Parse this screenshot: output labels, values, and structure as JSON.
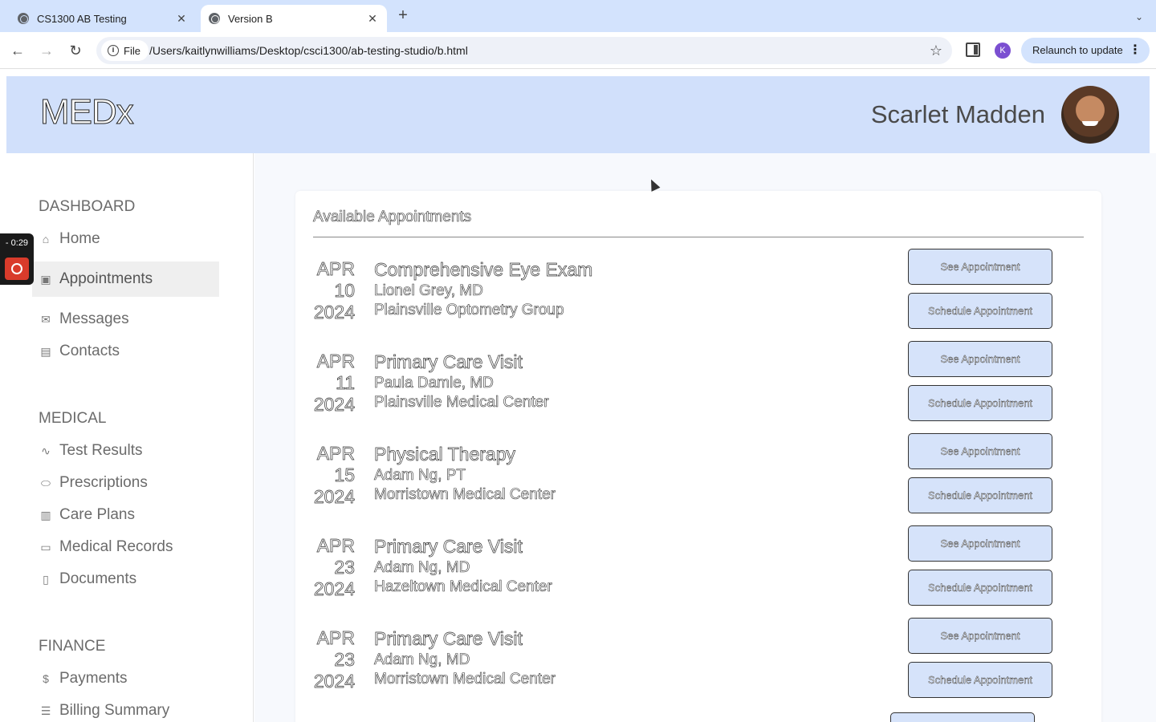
{
  "browser": {
    "tabs": [
      {
        "title": "CS1300 AB Testing",
        "active": false
      },
      {
        "title": "Version B",
        "active": true
      }
    ],
    "file_label": "File",
    "url": "/Users/kaitlynwilliams/Desktop/csci1300/ab-testing-studio/b.html",
    "profile_initial": "K",
    "relaunch_label": "Relaunch to update"
  },
  "header": {
    "logo": "MEDx",
    "user_name": "Scarlet Madden"
  },
  "recorder": {
    "time": "- 0:29"
  },
  "sidebar": {
    "sections": [
      {
        "title": "DASHBOARD",
        "items": [
          {
            "label": "Home",
            "icon": "home-icon"
          },
          {
            "label": "Appointments",
            "icon": "calendar-icon",
            "active": true
          },
          {
            "label": "Messages",
            "icon": "mail-icon"
          },
          {
            "label": "Contacts",
            "icon": "contact-card-icon"
          }
        ]
      },
      {
        "title": "MEDICAL",
        "items": [
          {
            "label": "Test Results",
            "icon": "pulse-icon"
          },
          {
            "label": "Prescriptions",
            "icon": "pill-icon"
          },
          {
            "label": "Care Plans",
            "icon": "hospital-icon"
          },
          {
            "label": "Medical Records",
            "icon": "folder-icon"
          },
          {
            "label": "Documents",
            "icon": "document-icon"
          }
        ]
      },
      {
        "title": "FINANCE",
        "items": [
          {
            "label": "Payments",
            "icon": "dollar-icon"
          },
          {
            "label": "Billing Summary",
            "icon": "list-icon"
          }
        ]
      }
    ]
  },
  "main": {
    "card_title": "Available Appointments",
    "see_label": "See Appointment",
    "schedule_label": "Schedule Appointment",
    "appointments": [
      {
        "month": "APR",
        "day": "10",
        "year": "2024",
        "title": "Comprehensive Eye Exam",
        "doctor": "Lionel Grey, MD",
        "location": "Plainsville Optometry Group"
      },
      {
        "month": "APR",
        "day": "11",
        "year": "2024",
        "title": "Primary Care Visit",
        "doctor": "Paula Damle, MD",
        "location": "Plainsville Medical Center"
      },
      {
        "month": "APR",
        "day": "15",
        "year": "2024",
        "title": "Physical Therapy",
        "doctor": "Adam Ng, PT",
        "location": "Morristown Medical Center"
      },
      {
        "month": "APR",
        "day": "23",
        "year": "2024",
        "title": "Primary Care Visit",
        "doctor": "Adam Ng, MD",
        "location": "Hazeltown Medical Center"
      },
      {
        "month": "APR",
        "day": "23",
        "year": "2024",
        "title": "Primary Care Visit",
        "doctor": "Adam Ng, MD",
        "location": "Morristown Medical Center"
      }
    ]
  }
}
